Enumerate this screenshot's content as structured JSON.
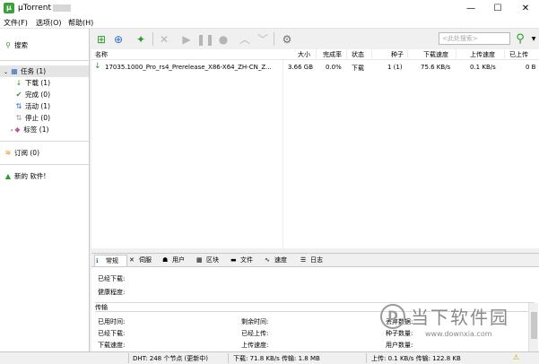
{
  "app": {
    "title": "µTorrent",
    "icon": "utorrent-logo-icon"
  },
  "window_controls": [
    "—",
    "☐",
    "✕"
  ],
  "menu": [
    "文件(F)",
    "选项(O)",
    "帮助(H)"
  ],
  "sidebar": {
    "search_label": "搜索",
    "torrents_label": "任务 (1)",
    "items": [
      {
        "label": "下载 (1)",
        "icon": "download-arrow-icon",
        "color": "#2e9b2e"
      },
      {
        "label": "完成 (0)",
        "icon": "check-icon",
        "color": "#2e9b2e"
      },
      {
        "label": "活动 (1)",
        "icon": "active-arrows-icon",
        "color": "#2e6fbf"
      },
      {
        "label": "停止 (0)",
        "icon": "stopped-arrows-icon",
        "color": "#9a9a9a"
      },
      {
        "label": "标签 (1)",
        "icon": "label-icon",
        "color": "#c85a9c"
      }
    ],
    "feeds_label": "订阅 (0)",
    "new_software_label": "新的 软件!"
  },
  "toolbar": {
    "search_placeholder": "<此处搜索>",
    "buttons": [
      "add-torrent-icon",
      "add-url-icon",
      "create-torrent-icon",
      "remove-icon",
      "start-icon",
      "pause-icon",
      "stop-icon",
      "move-up-icon",
      "move-down-icon",
      "preferences-icon"
    ]
  },
  "torrent_list": {
    "columns": [
      "名称",
      "大小",
      "完成率",
      "状态",
      "种子",
      "下载速度",
      "上传速度",
      "已上传"
    ],
    "rows": [
      {
        "name": "17035.1000_Pro_rs4_Prerelease_X86-X64_ZH-CN_Z...",
        "size": "3.66 GB",
        "done": "0.0%",
        "status": "下载",
        "seeds": "1 (1)",
        "down_speed": "75.6 KB/s",
        "up_speed": "0.1 KB/s",
        "uploaded": "0 B"
      }
    ]
  },
  "detail_tabs": [
    "常规",
    "伺服",
    "用户",
    "区块",
    "文件",
    "速度",
    "日志"
  ],
  "detail": {
    "downloaded_label": "已经下载:",
    "availability_label": "健康程度:",
    "transfer_header": "传输",
    "time_elapsed_label": "已用时间:",
    "remaining_label": "剩余时间:",
    "wasted_label": "丢弃数据:",
    "downloaded2_label": "已经下载:",
    "uploaded_label": "已经上传:",
    "seeds_label": "种子数量:",
    "down_speed_label": "下载速度:",
    "up_speed_label": "上传速度:",
    "peers_label": "用户数量:"
  },
  "status": {
    "dht": "DHT: 248 个节点 (更新中)",
    "download": "下载: 71.8 KB/s 传输: 1.8 MB",
    "upload": "上传: 0.1 KB/s 传输: 122.8 KB"
  },
  "watermark": {
    "title": "当下软件园",
    "url": "www.downxia.com",
    "logo_char": "D"
  }
}
